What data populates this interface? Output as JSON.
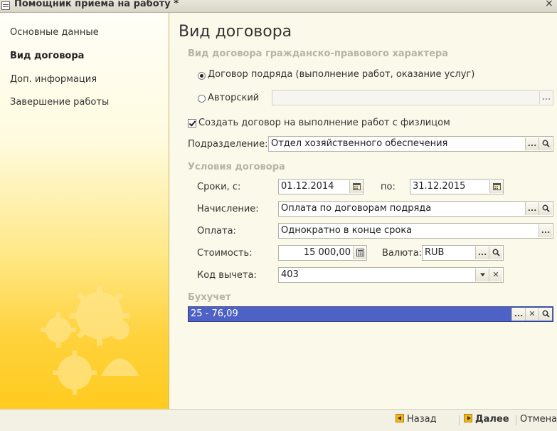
{
  "window": {
    "title": "Помощник приема на работу *",
    "close_label": "×"
  },
  "sidebar": {
    "items": [
      {
        "label": "Основные данные",
        "active": false
      },
      {
        "label": "Вид договора",
        "active": true
      },
      {
        "label": "Доп. информация",
        "active": false
      },
      {
        "label": "Завершение работы",
        "active": false
      }
    ]
  },
  "main": {
    "heading": "Вид договора",
    "civil_section": "Вид договора гражданско-правового характера",
    "radio_contract": {
      "label": "Договор подряда (выполнение работ, оказание услуг)",
      "checked": true
    },
    "radio_author": {
      "label": "Авторский",
      "checked": false,
      "value": ""
    },
    "create_contract_checkbox": {
      "label": "Создать договор на выполнение работ с физлицом",
      "checked": true
    },
    "department": {
      "label": "Подразделение:",
      "value": "Отдел хозяйственного обеспечения"
    },
    "conditions_section": "Условия договора",
    "dates": {
      "label": "Сроки, с:",
      "from": "01.12.2014",
      "to_label": "по:",
      "to": "31.12.2015"
    },
    "accrual": {
      "label": "Начисление:",
      "value": "Оплата по договорам подряда"
    },
    "payment": {
      "label": "Оплата:",
      "value": "Однократно в конце срока"
    },
    "cost": {
      "label": "Стоимость:",
      "value": "15 000,00"
    },
    "currency": {
      "label": "Валюта:",
      "value": "RUB"
    },
    "deduction": {
      "label": "Код вычета:",
      "value": "403"
    },
    "accounting_section": "Бухучет",
    "accounting": {
      "value": "25 - 76,09"
    },
    "buttons": {
      "dots": "...",
      "clear": "✕"
    }
  },
  "footer": {
    "back_label": "Назад",
    "next_label": "Далее",
    "cancel_label": "Отмена"
  },
  "colors": {
    "accent_yellow": "#ffcb1f",
    "selection": "#4e61c5",
    "section_gray": "#b8b4a4"
  }
}
